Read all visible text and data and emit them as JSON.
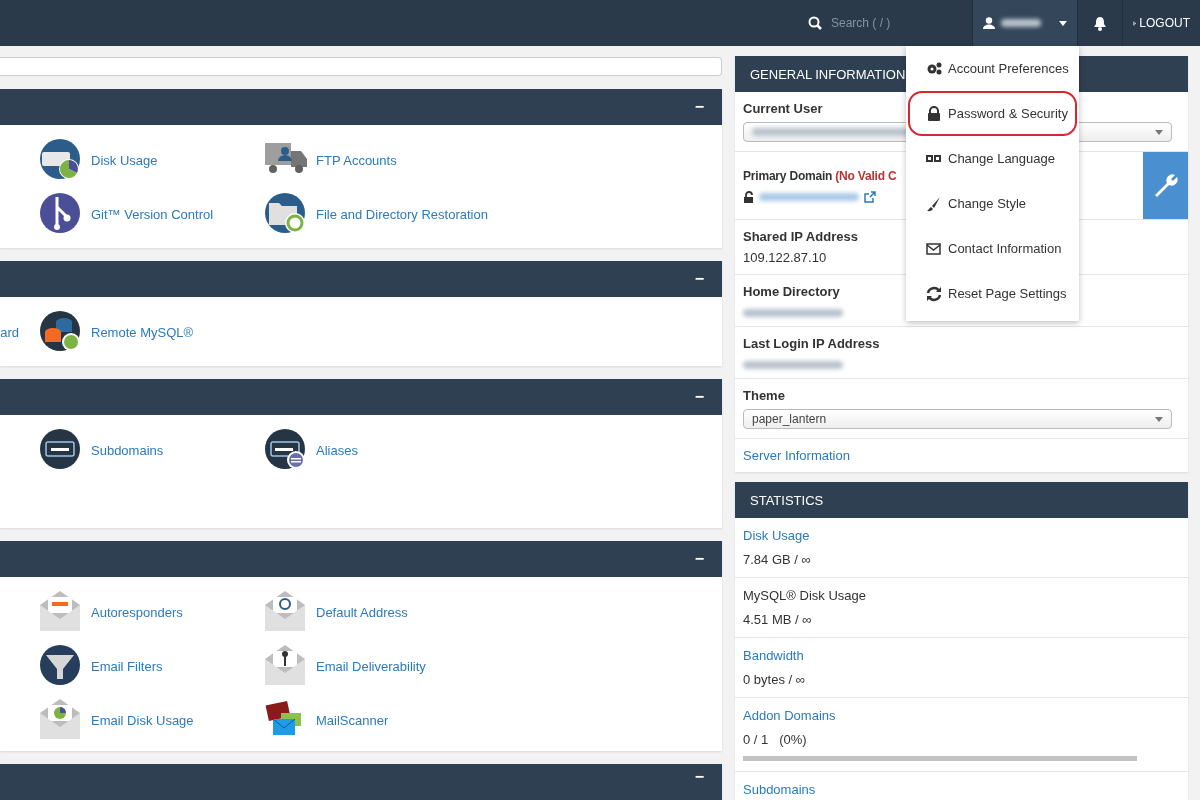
{
  "topbar": {
    "search": {
      "placeholder": "Search ( / )"
    },
    "user_menu": {
      "expanded": true,
      "items": [
        {
          "label": "Account Preferences",
          "kind": "gears",
          "highlighted": false
        },
        {
          "label": "Password & Security",
          "kind": "lock",
          "highlighted": true
        },
        {
          "label": "Change Language",
          "kind": "language",
          "highlighted": false
        },
        {
          "label": "Change Style",
          "kind": "brush",
          "highlighted": false
        },
        {
          "label": "Contact Information",
          "kind": "envelope",
          "highlighted": false
        },
        {
          "label": "Reset Page Settings",
          "kind": "refresh",
          "highlighted": false
        }
      ]
    },
    "logout": "LOGOUT"
  },
  "panels": [
    {
      "toggle": "−",
      "rows": [
        [
          {
            "kind": "disk",
            "label": "Disk Usage"
          },
          {
            "kind": "ftp",
            "label": "FTP Accounts"
          }
        ],
        [
          {
            "kind": "git",
            "label": "Git™ Version Control"
          },
          {
            "kind": "restore",
            "label": "File and Directory Restoration"
          }
        ]
      ]
    },
    {
      "toggle": "−",
      "lead": "ard",
      "rows": [
        [
          {
            "kind": "mysql",
            "label": "Remote MySQL®"
          }
        ]
      ]
    },
    {
      "toggle": "−",
      "rows": [
        [
          {
            "kind": "sub",
            "label": "Subdomains"
          },
          {
            "kind": "alias",
            "label": "Aliases"
          }
        ]
      ]
    },
    {
      "toggle": "−",
      "rows": [
        [
          {
            "kind": "auto",
            "label": "Autoresponders"
          },
          {
            "kind": "at",
            "label": "Default Address"
          }
        ],
        [
          {
            "kind": "filter",
            "label": "Email Filters"
          },
          {
            "kind": "key",
            "label": "Email Deliverability"
          }
        ],
        [
          {
            "kind": "pie",
            "label": "Email Disk Usage"
          },
          {
            "kind": "scanner",
            "label": "MailScanner"
          }
        ]
      ]
    },
    {
      "toggle": "−"
    }
  ],
  "general": {
    "title": "GENERAL INFORMATION",
    "rows": [
      {
        "kind": "select",
        "label": "Current User"
      },
      {
        "kind": "domain",
        "label": "Primary Domain",
        "note": "(No Valid C"
      },
      {
        "kind": "text",
        "label": "Shared IP Address",
        "value": "109.122.87.10"
      },
      {
        "kind": "hidden",
        "label": "Home Directory"
      },
      {
        "kind": "hidden",
        "label": "Last Login IP Address"
      },
      {
        "kind": "select",
        "label": "Theme",
        "value": "paper_lantern"
      },
      {
        "kind": "link",
        "label": "Server Information"
      }
    ]
  },
  "statistics": {
    "title": "STATISTICS",
    "rows": [
      {
        "label": "Disk Usage",
        "link": true,
        "value": "7.84 GB / ∞"
      },
      {
        "label": "MySQL® Disk Usage",
        "link": false,
        "value": "4.51 MB / ∞"
      },
      {
        "label": "Bandwidth",
        "link": true,
        "value": "0 bytes / ∞"
      },
      {
        "label": "Addon Domains",
        "link": true,
        "value": "0 / 1   (0%)",
        "level": 0
      },
      {
        "label": "Subdomains",
        "link": true
      }
    ]
  }
}
